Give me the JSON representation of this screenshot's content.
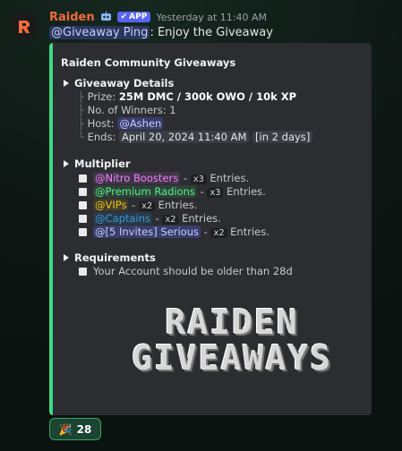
{
  "message": {
    "author": "Raiden",
    "app_badge": "APP",
    "timestamp": "Yesterday at 11:40 AM",
    "mention": "@Giveaway Ping",
    "text": ": Enjoy the Giveaway"
  },
  "embed": {
    "title": "Raiden Community Giveaways",
    "accent_color": "#3ddc84",
    "details": {
      "heading": "Giveaway Details",
      "prize_label": "Prize:",
      "prize_value": "25M DMC / 300k OWO / 10k XP",
      "winners": "No. of Winners: 1",
      "host_label": "Host:",
      "host_value": "@Ashen",
      "ends_label": "Ends:",
      "ends_date": "April 20, 2024 11:40 AM",
      "ends_relative": "in 2 days"
    },
    "multiplier": {
      "heading": "Multiplier",
      "items": [
        {
          "role": "@Nitro Boosters",
          "mult": "x3",
          "entries": "Entries.",
          "color": "#f47fff",
          "bg": "rgba(244,127,255,0.1)"
        },
        {
          "role": "@Premium Radions",
          "mult": "x3",
          "entries": "Entries.",
          "color": "#57f287",
          "bg": "rgba(87,242,135,0.1)"
        },
        {
          "role": "@VIPs",
          "mult": "x2",
          "entries": "Entries.",
          "color": "#f1c40f",
          "bg": "rgba(241,196,15,0.1)"
        },
        {
          "role": "@Captains",
          "mult": "x2",
          "entries": "Entries.",
          "color": "#3498db",
          "bg": "rgba(52,152,219,0.12)"
        },
        {
          "role": "@[5 Invites] Serious",
          "mult": "x2",
          "entries": "Entries.",
          "color": "#c9cdfb",
          "bg": "rgba(88,101,242,0.3)"
        }
      ]
    },
    "requirements": {
      "heading": "Requirements",
      "item": "Your Account should be older than 28d"
    },
    "banner": {
      "line1": "RAIDEN",
      "line2": "GIVEAWAYS"
    }
  },
  "reaction": {
    "emoji_icon": "party-popper",
    "emoji": "🎉",
    "count": "28"
  }
}
